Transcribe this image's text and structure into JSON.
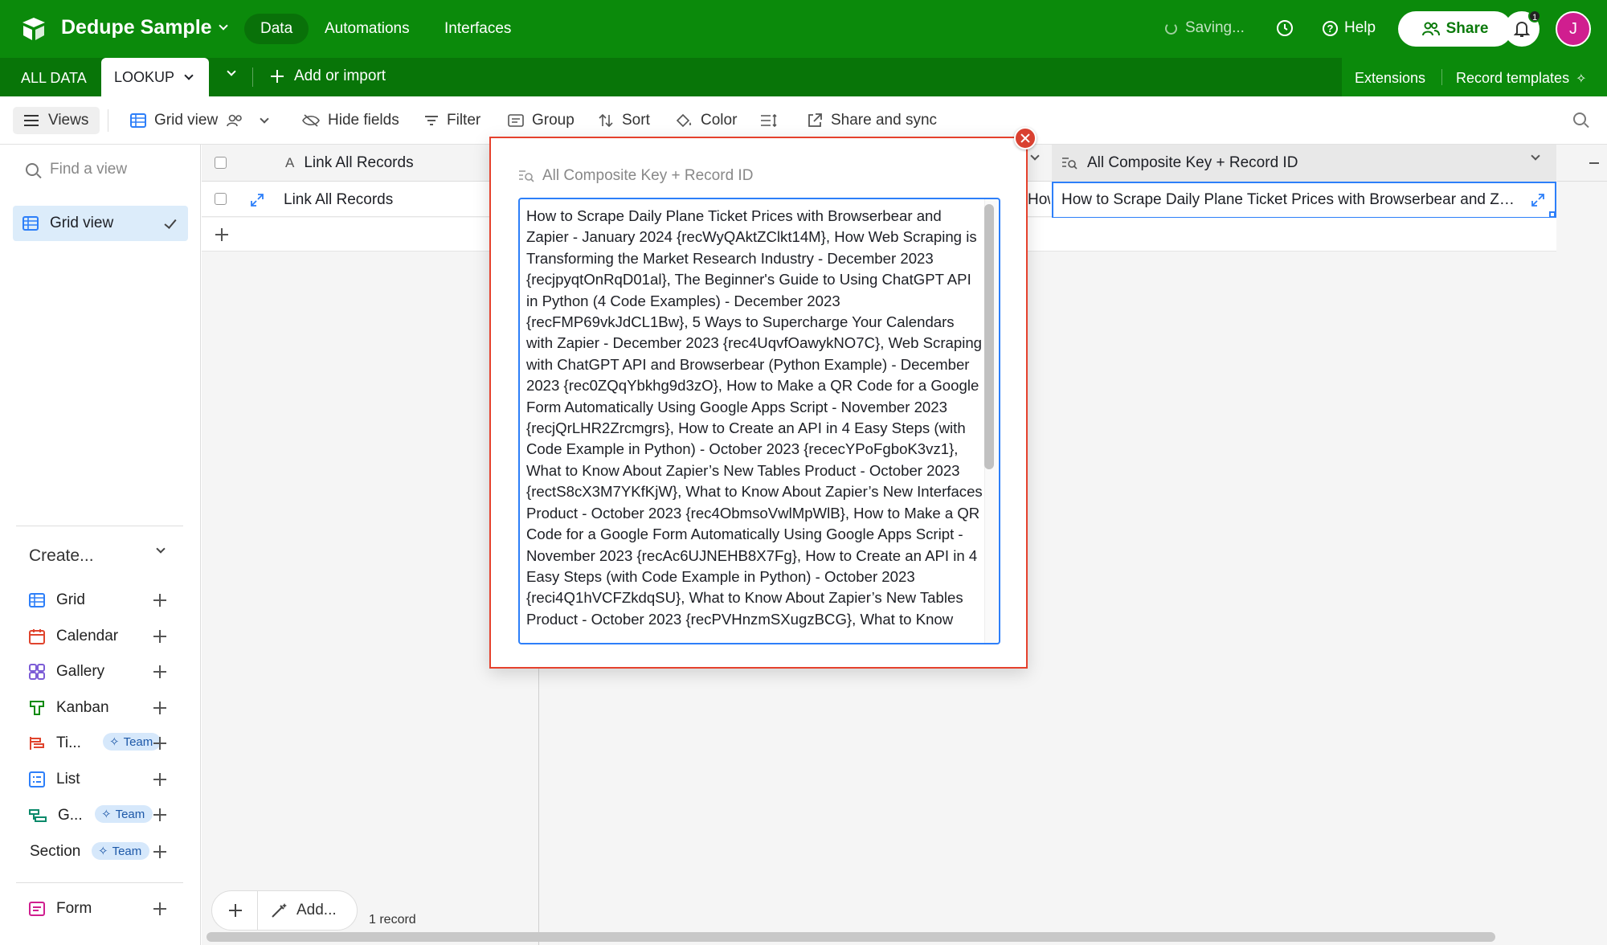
{
  "topbar": {
    "base_name": "Dedupe Sample",
    "tabs": [
      {
        "label": "Data",
        "active": true
      },
      {
        "label": "Automations",
        "active": false
      },
      {
        "label": "Interfaces",
        "active": false
      }
    ],
    "saving_label": "Saving...",
    "help_label": "Help",
    "share_label": "Share",
    "notification_count": "1",
    "avatar_initial": "J",
    "brand_color": "#0b8a0b"
  },
  "tables": {
    "items": [
      "ALL DATA",
      "LOOKUP"
    ],
    "active": "LOOKUP",
    "add_import_label": "Add or import",
    "extensions_label": "Extensions",
    "record_templates_label": "Record templates"
  },
  "toolbar": {
    "views_label": "Views",
    "grid_view_label": "Grid view",
    "hide_fields_label": "Hide fields",
    "filter_label": "Filter",
    "group_label": "Group",
    "sort_label": "Sort",
    "color_label": "Color",
    "share_sync_label": "Share and sync"
  },
  "sidebar": {
    "find_placeholder": "Find a view",
    "current_view": "Grid view",
    "create_label": "Create...",
    "create_items": [
      {
        "label": "Grid",
        "icon": "grid-icon",
        "team": false
      },
      {
        "label": "Calendar",
        "icon": "calendar-icon",
        "team": false
      },
      {
        "label": "Gallery",
        "icon": "gallery-icon",
        "team": false
      },
      {
        "label": "Kanban",
        "icon": "kanban-icon",
        "team": false
      },
      {
        "label": "Ti...",
        "icon": "timeline-icon",
        "team": true
      },
      {
        "label": "List",
        "icon": "list-icon",
        "team": false
      },
      {
        "label": "G...",
        "icon": "gantt-icon",
        "team": true
      },
      {
        "label": "Section",
        "icon": "",
        "team": true
      },
      {
        "label": "Form",
        "icon": "form-icon",
        "team": false
      }
    ],
    "team_label": "Team"
  },
  "grid": {
    "columns": [
      {
        "name": "Link All Records",
        "type": "primary"
      },
      {
        "name": "All Composite Key + Record ID",
        "type": "lookup"
      }
    ],
    "row": {
      "primary_value": "Link All Records",
      "lookup_value": "How to Scrape Daily Plane Ticket Prices with Browserbear and Zap...",
      "partial_value": "How"
    },
    "add_label": "Add...",
    "record_count": "1 record"
  },
  "modal": {
    "field_label": "All Composite Key + Record ID",
    "value": "How to Scrape Daily Plane Ticket Prices with Browserbear and Zapier - January 2024 {recWyQAktZClkt14M}, How Web Scraping is Transforming the Market Research Industry - December 2023 {recjpyqtOnRqD01al}, The Beginner's Guide to Using ChatGPT API in Python (4 Code Examples) - December 2023 {recFMP69vkJdCL1Bw}, 5 Ways to Supercharge Your Calendars with Zapier - December 2023 {rec4UqvfOawykNO7C}, Web Scraping with ChatGPT API and Browserbear (Python Example) - December 2023 {rec0ZQqYbkhg9d3zO}, How to Make a QR Code for a Google Form Automatically Using Google Apps Script - November 2023 {recjQrLHR2Zrcmgrs}, How to Create an API in 4 Easy Steps (with Code Example in Python) - October 2023 {rececYPoFgboK3vz1}, What to Know About Zapier’s New Tables Product - October 2023 {rectS8cX3M7YKfKjW}, What to Know About Zapier’s New Interfaces Product - October 2023 {rec4ObmsoVwlMpWlB}, How to Make a QR Code for a Google Form Automatically Using Google Apps Script - November 2023 {recAc6UJNEHB8X7Fg}, How to Create an API in 4 Easy Steps (with Code Example in Python) - October 2023 {reci4Q1hVCFZkdqSU}, What to Know About Zapier’s New Tables Product - October 2023 {recPVHnzmSXugzBCG}, What to Know",
    "border_color": "#e5412d",
    "focus_color": "#2d7ff9"
  }
}
